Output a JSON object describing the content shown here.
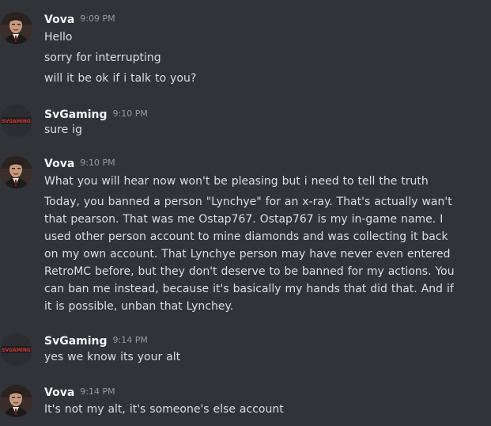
{
  "channel": {
    "messages": [
      {
        "author": "Vova",
        "time": "9:09 PM",
        "avatar_icon": "vova-avatar-icon",
        "lines": [
          "Hello",
          "sorry for interrupting",
          "will it be ok if i talk to you?"
        ]
      },
      {
        "author": "SvGaming",
        "time": "9:10 PM",
        "avatar_icon": "svgaming-logo-icon",
        "lines": [
          "sure ig"
        ]
      },
      {
        "author": "Vova",
        "time": "9:10 PM",
        "avatar_icon": "vova-avatar-icon",
        "lines": [
          "What you will hear now won't be pleasing but i need to tell the truth",
          "Today, you banned a person \"Lynchye\" for an x-ray. That's actually wan't that pearson. That was me Ostap767. Ostap767 is my in-game name. I used other person account to mine diamonds and was collecting it back on my own account. That Lynchye person may have never even entered RetroMC before, but they don't deserve to be banned for my actions. You can ban me instead, because it's basically my hands that did that. And if it is possible, unban that Lynchey."
        ]
      },
      {
        "author": "SvGaming",
        "time": "9:14 PM",
        "avatar_icon": "svgaming-logo-icon",
        "lines": [
          "yes we know its your alt"
        ]
      },
      {
        "author": "Vova",
        "time": "9:14 PM",
        "avatar_icon": "vova-avatar-icon",
        "lines": [
          "It's not my alt, it's someone's else account"
        ]
      }
    ]
  },
  "colors": {
    "background": "#313338",
    "text": "#dbdee1",
    "username": "#f2f3f5",
    "timestamp": "#949ba4"
  }
}
